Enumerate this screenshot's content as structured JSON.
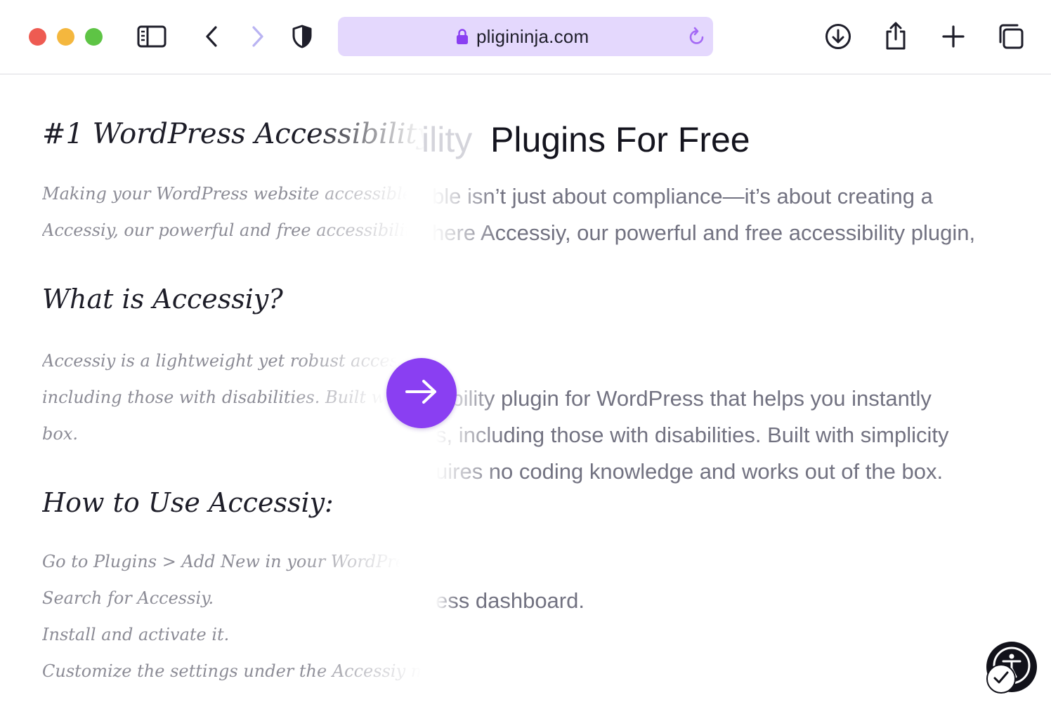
{
  "browser": {
    "url": "pligininja.com",
    "icons": [
      "sidebar-icon",
      "back-icon",
      "forward-icon",
      "shield-icon",
      "lock-icon",
      "reload-icon",
      "download-icon",
      "share-icon",
      "new-tab-icon",
      "tabs-icon"
    ],
    "colors": {
      "close": "#ee5b52",
      "minimize": "#f4b73e",
      "maximize": "#5ec445",
      "address_bar": "#e4d8fd",
      "accent": "#8a3ff2"
    }
  },
  "page": {
    "title_script": "#1 WordPress Accessibility",
    "title_faded": "ility",
    "title_plain": "Plugins For Free",
    "intro_script": [
      "Making your WordPress website accessible isn't",
      "Accessiy, our powerful and free accessibility plugin,"
    ],
    "intro_plain": [
      "ble isn’t just about compliance—it’s about creating a",
      "here Accessiy, our powerful and free accessibility plugin,"
    ],
    "what_heading": "What is Accessiy?",
    "what_script": [
      "Accessiy is a lightweight yet robust accessibility plug",
      "including those with disabilities. Built with simpl",
      "box."
    ],
    "what_plain": [
      "sibility plugin for WordPress that helps you instantly",
      "s, including those with disabilities. Built with simplicity",
      "uires no coding knowledge and works out of the box."
    ],
    "howto_heading": "How to Use Accessiy:",
    "howto_script": [
      "Go to Plugins > Add New in your WordPress",
      "Search for Accessiy.",
      "Install and activate it.",
      "Customize the settings under the Accessiy menu to suit"
    ],
    "howto_plain": [
      "ess dashboard."
    ]
  },
  "widgets": {
    "next_button_icon": "arrow-right-icon",
    "accessibility_icon": "accessibility-person-icon",
    "accessibility_check_icon": "checkmark-icon"
  }
}
